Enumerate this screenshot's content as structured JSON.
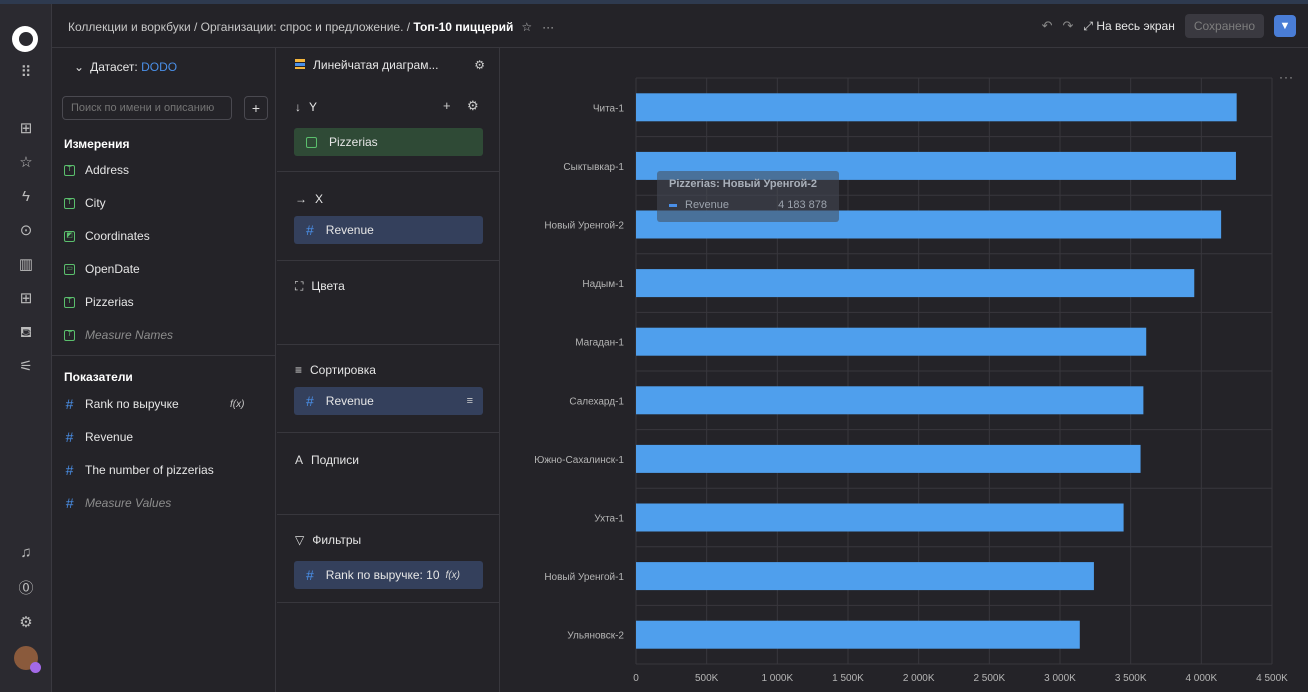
{
  "header": {
    "breadcrumb": "Коллекции и воркбуки / Организации: спрос и предложение. / ",
    "current": "Топ-10 пиццерий",
    "star_icon": "star-icon",
    "more": "···",
    "fullscreen": "На весь экран",
    "saved": "Сохранено"
  },
  "dataset": {
    "label": "Датасет:",
    "name": "DODO",
    "search_placeholder": "Поиск по имени и описанию",
    "add": "+",
    "dimensions_title": "Измерения",
    "dimensions": [
      "Address",
      "City",
      "Coordinates",
      "OpenDate",
      "Pizzerias",
      "Measure Names"
    ],
    "measures_title": "Показатели",
    "measures": [
      "Rank по выручке",
      "Revenue",
      "The number of pizzerias",
      "Measure Values"
    ],
    "fx": "f(x)"
  },
  "wizard": {
    "chart_type": "Линейчатая диаграм...",
    "y_title": "Y",
    "y_field": "Pizzerias",
    "x_title": "X",
    "x_field": "Revenue",
    "colors_title": "Цвета",
    "sort_title": "Сортировка",
    "sort_field": "Revenue",
    "labels_title": "Подписи",
    "filters_title": "Фильтры",
    "filter_field": "Rank по выручке: 10",
    "filter_fx": "f(x)"
  },
  "chart_data": {
    "type": "bar",
    "orientation": "horizontal",
    "categories": [
      "Чита-1",
      "Сыктывкар-1",
      "Новый Уренгой-2",
      "Надым-1",
      "Магадан-1",
      "Салехард-1",
      "Южно-Сахалинск-1",
      "Ухта-1",
      "Новый Уренгой-1",
      "Ульяновск-2"
    ],
    "series": [
      {
        "name": "Revenue",
        "values": [
          4250000,
          4245000,
          4140000,
          3950000,
          3610000,
          3590000,
          3570000,
          3450000,
          3240000,
          3140000
        ]
      }
    ],
    "xlim": [
      0,
      4500000
    ],
    "xticks": [
      "0",
      "500K",
      "1 000K",
      "1 500K",
      "2 000K",
      "2 500K",
      "3 000K",
      "3 500K",
      "4 000K",
      "4 500K"
    ],
    "bar_color": "#4f9fed",
    "grid": true,
    "tooltip": {
      "title": "Pizzerias: Новый Уренгой-2",
      "series": "Revenue",
      "value": "4 183 878"
    }
  }
}
